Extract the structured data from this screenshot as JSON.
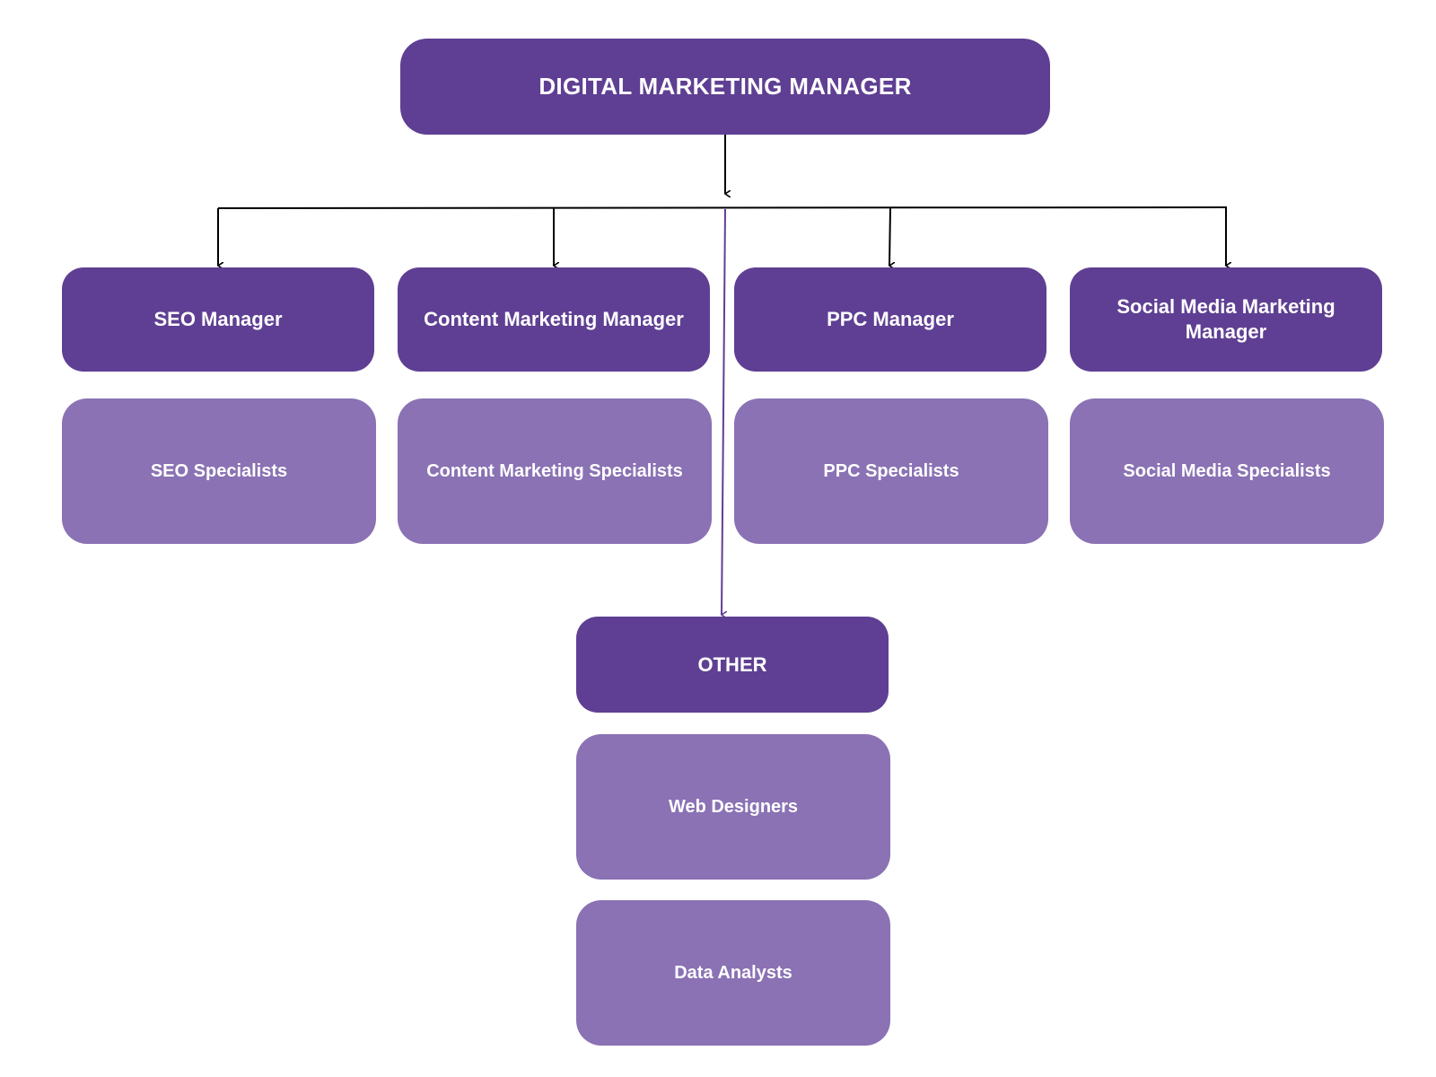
{
  "diagram": {
    "type": "org-chart",
    "colors": {
      "manager_fill": "#5f3f93",
      "specialist_fill": "#8a72b4",
      "text": "#ffffff",
      "connector": "#000000",
      "other_connector": "#5f3f93"
    },
    "root": {
      "label": "DIGITAL MARKETING MANAGER"
    },
    "departments": [
      {
        "manager": "SEO Manager",
        "team": "SEO Specialists"
      },
      {
        "manager": "Content Marketing Manager",
        "team": "Content Marketing Specialists"
      },
      {
        "manager": "PPC Manager",
        "team": "PPC Specialists"
      },
      {
        "manager": "Social Media Marketing Manager",
        "team": "Social Media Specialists"
      }
    ],
    "other": {
      "label": "OTHER",
      "teams": [
        "Web Designers",
        "Data Analysts"
      ]
    }
  }
}
